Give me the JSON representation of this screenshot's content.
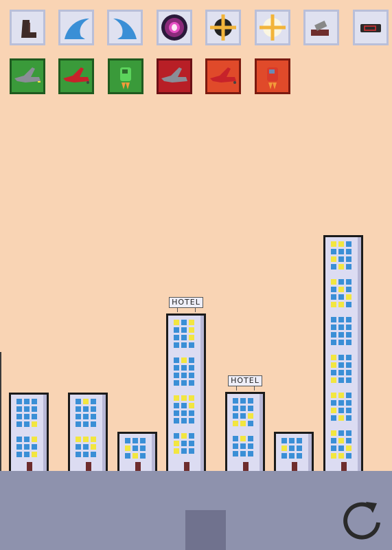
{
  "colors": {
    "sky": "#f9d4b4",
    "ground": "#8e92ad",
    "pad": "#70728e",
    "tile_light": "#dfe1f0",
    "tile_green": "#3a9a3a",
    "tile_red": "#b81f26",
    "window_blue": "#3a8fd6",
    "window_yellow": "#f2e640",
    "reload_icon": "#2a2a2a"
  },
  "powerups_row1": [
    {
      "name": "boot-tile",
      "icon": "boot-icon"
    },
    {
      "name": "wave-tile",
      "icon": "wave-icon"
    },
    {
      "name": "wave-tile-2",
      "icon": "wave-icon"
    },
    {
      "name": "portal-tile",
      "icon": "portal-icon"
    },
    {
      "name": "crosshair-tile",
      "icon": "crosshair-icon"
    },
    {
      "name": "sparkle-tile",
      "icon": "sparkle-icon"
    },
    {
      "name": "bandage-tile",
      "icon": "bandage-icon"
    },
    {
      "name": "battery-tile",
      "icon": "battery-icon"
    }
  ],
  "vehicles_row2": [
    {
      "name": "plane-gray-green-tile",
      "icon": "plane-icon",
      "team": "green"
    },
    {
      "name": "plane-red-green-tile",
      "icon": "plane-icon",
      "team": "green"
    },
    {
      "name": "jetpack-green-tile",
      "icon": "jetpack-icon",
      "team": "green"
    },
    {
      "name": "plane-gray-red-tile",
      "icon": "plane-icon",
      "team": "red"
    },
    {
      "name": "plane-red-red-tile",
      "icon": "plane-icon",
      "team": "red"
    },
    {
      "name": "jetpack-red-tile",
      "icon": "jetpack-icon",
      "team": "red"
    }
  ],
  "buildings": [
    {
      "sign": ""
    },
    {
      "sign": ""
    },
    {
      "sign": ""
    },
    {
      "sign": "HOTEL"
    },
    {
      "sign": "HOTEL"
    },
    {
      "sign": ""
    },
    {
      "sign": ""
    }
  ],
  "controls": {
    "reload_icon": "reload-icon"
  }
}
